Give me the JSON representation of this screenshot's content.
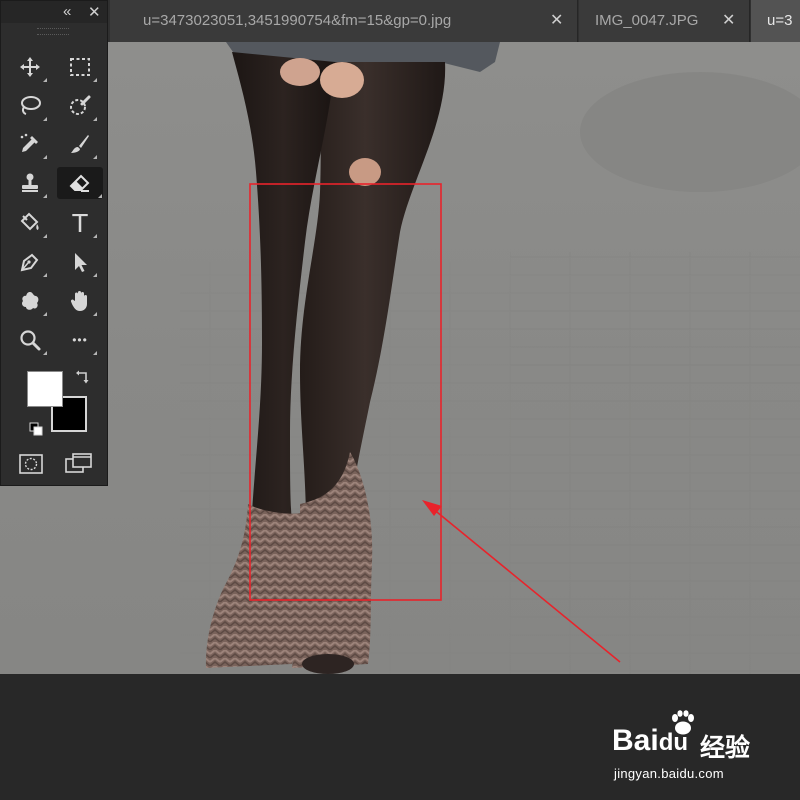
{
  "tabs": [
    {
      "label": "u=3473023051,3451990754&fm=15&gp=0.jpg",
      "close": "✕"
    },
    {
      "label": "IMG_0047.JPG",
      "close": "✕"
    },
    {
      "label": "u=3",
      "active": true
    }
  ],
  "toolbox": {
    "collapse_glyph": "«",
    "close_glyph": "✕",
    "tools": [
      {
        "name": "move-tool",
        "icon": "move-icon"
      },
      {
        "name": "rectangular-marquee-tool",
        "icon": "marquee-icon"
      },
      {
        "name": "lasso-tool",
        "icon": "lasso-icon"
      },
      {
        "name": "quick-selection-tool",
        "icon": "quick-selection-icon"
      },
      {
        "name": "eyedropper-tool",
        "icon": "eyedropper-icon"
      },
      {
        "name": "brush-tool",
        "icon": "brush-icon"
      },
      {
        "name": "clone-stamp-tool",
        "icon": "stamp-icon"
      },
      {
        "name": "eraser-tool",
        "icon": "eraser-icon",
        "active": true
      },
      {
        "name": "paint-bucket-tool",
        "icon": "paint-bucket-icon"
      },
      {
        "name": "type-tool",
        "icon": "type-icon",
        "glyph": "T"
      },
      {
        "name": "pen-tool",
        "icon": "pen-icon"
      },
      {
        "name": "path-selection-tool",
        "icon": "arrow-icon"
      },
      {
        "name": "custom-shape-tool",
        "icon": "shape-icon"
      },
      {
        "name": "hand-tool",
        "icon": "hand-icon"
      },
      {
        "name": "zoom-tool",
        "icon": "zoom-icon"
      },
      {
        "name": "more-tools",
        "icon": "ellipsis-icon",
        "glyph": "•••"
      }
    ],
    "foreground_color": "#ffffff",
    "background_color": "#000000"
  },
  "annotation": {
    "color": "#e8232b"
  },
  "watermark": {
    "brand": "Bai",
    "brand_suffix": "du",
    "cn_text": "经验",
    "url": "jingyan.baidu.com"
  }
}
